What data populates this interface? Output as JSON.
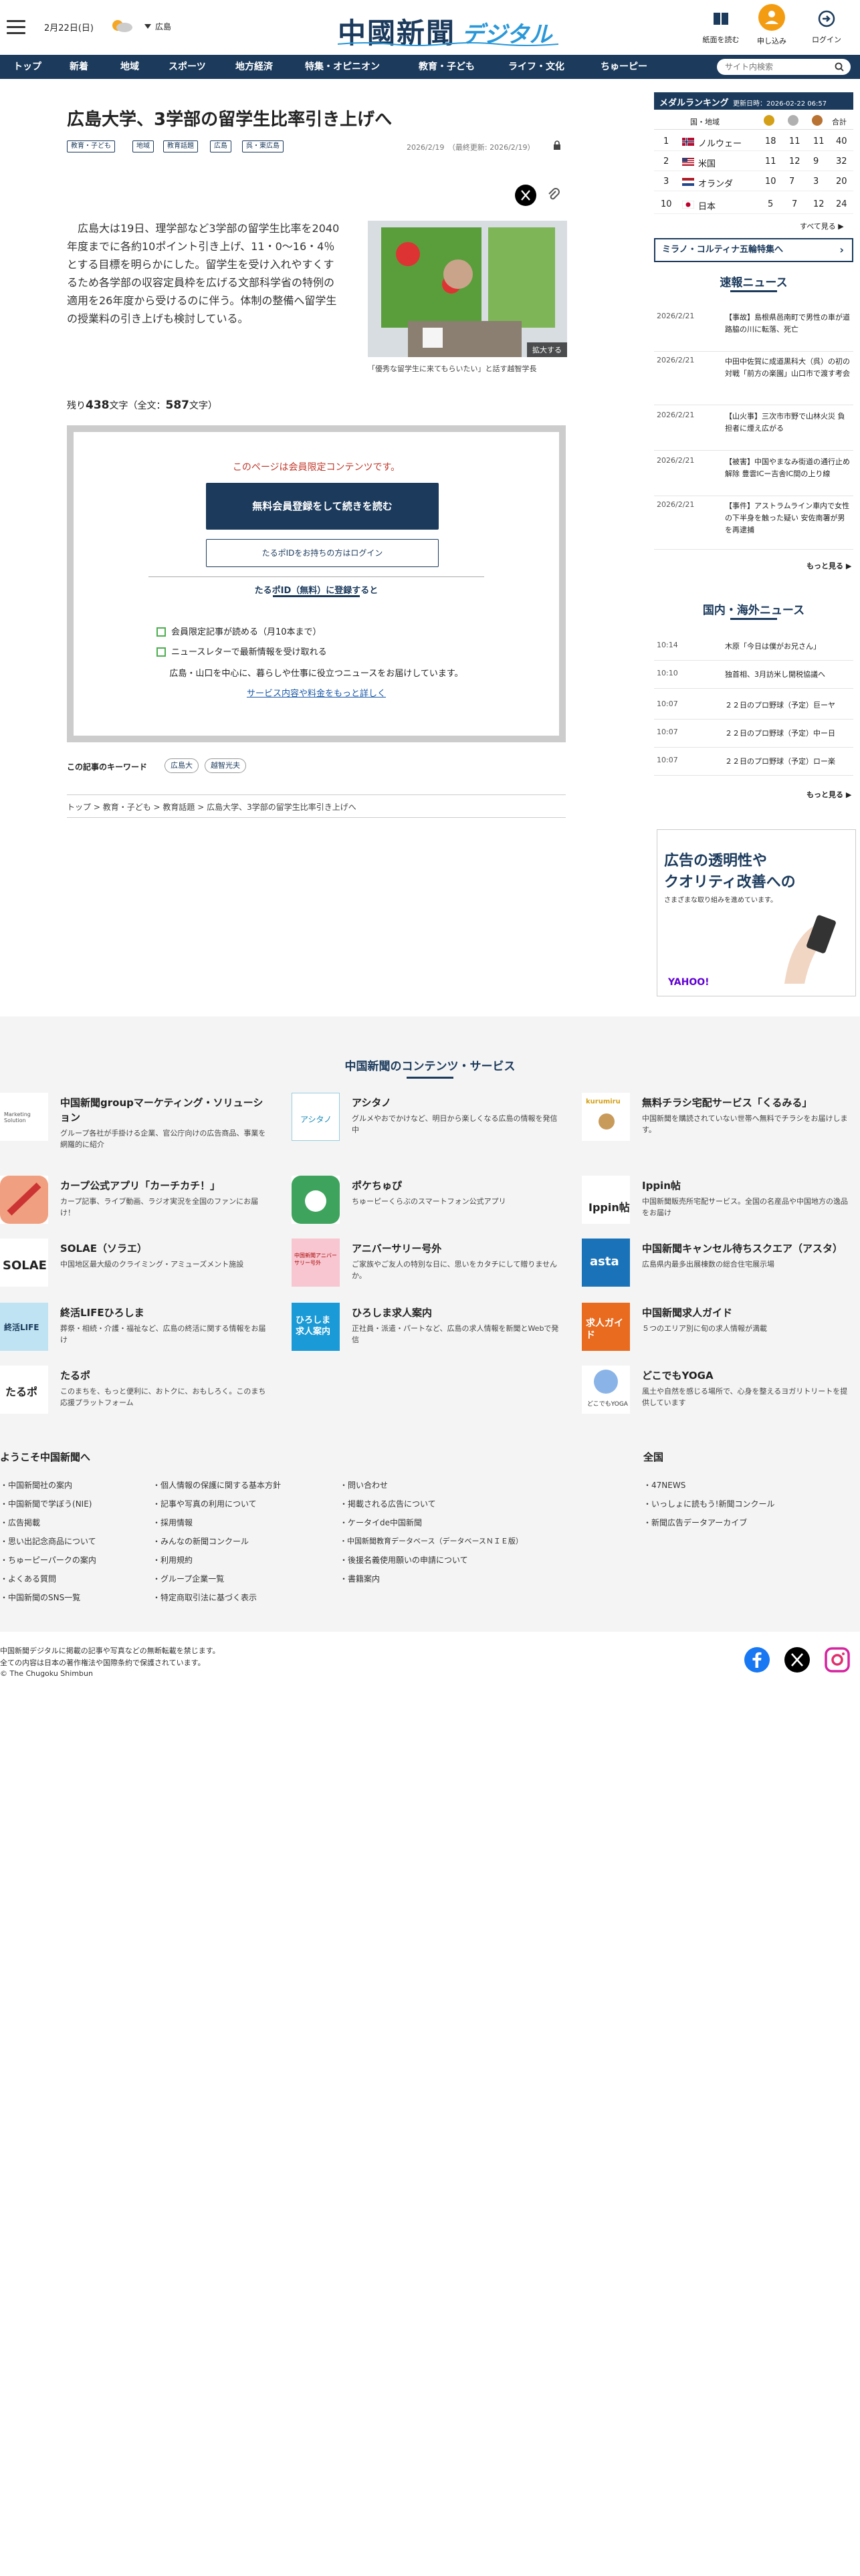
{
  "header": {
    "date": "2月22日(日)",
    "region": "広島",
    "logo_main": "中國新聞",
    "logo_sub": "デジタル",
    "icons": [
      {
        "label": "紙面を読む",
        "icon": "newspaper-icon"
      },
      {
        "label": "申し込み",
        "icon": "signup-icon"
      },
      {
        "label": "ログイン",
        "icon": "login-icon"
      }
    ]
  },
  "nav": {
    "items": [
      "トップ",
      "新着",
      "地域",
      "スポーツ",
      "地方経済",
      "特集・オピニオン",
      "教育・子ども",
      "ライフ・文化",
      "ちゅーピー"
    ],
    "search_placeholder": "サイト内検索"
  },
  "article": {
    "title": "広島大学、3学部の留学生比率引き上げへ",
    "tags": [
      "教育・子ども",
      "地域",
      "教育話題",
      "広島",
      "呉・東広島"
    ],
    "date": "2026/2/19",
    "updated": "（最終更新: 2026/2/19）",
    "body": "　広島大は19日、理学部など3学部の留学生比率を2040年度までに各約10ポイント引き上げ、11・0〜16・4％とする目標を明らかにした。留学生を受け入れやすくするため各学部の収容定員枠を広げる文部科学省の特例の適用を26年度から受けるのに伴う。体制の整備へ留学生の授業料の引き上げも検討している。",
    "photo_enlarge": "拡大する",
    "photo_caption": "「優秀な留学生に来てもらいたい」と話す越智学長",
    "remain_prefix": "残り",
    "remain_count": "438",
    "remain_mid": "文字（全文：",
    "total_count": "587",
    "remain_suffix": "文字）"
  },
  "paywall": {
    "limited": "このページは会員限定コンテンツです。",
    "register_btn": "無料会員登録をして続きを読む",
    "login_btn": "たるポIDをお持ちの方はログイン",
    "reg_heading": "たるポID（無料）に登録すると",
    "benefits": [
      "会員限定記事が読める（月10本まで）",
      "ニュースレターで最新情報を受け取れる"
    ],
    "note": "広島・山口を中心に、暮らしや仕事に役立つニュースをお届けしています。",
    "more_link": "サービス内容や料金をもっと詳しく"
  },
  "keywords": {
    "label": "この記事のキーワード",
    "items": [
      "広島大",
      "越智光夫"
    ]
  },
  "breadcrumb": [
    "トップ",
    "教育・子ども",
    "教育話題",
    "広島大学、3学部の留学生比率引き上げへ"
  ],
  "medal": {
    "title": "メダルランキング",
    "updated": "更新日時：2026-02-22 06:57",
    "col_country": "国・地域",
    "col_total": "合計",
    "rows": [
      {
        "rank": "1",
        "country": "ノルウェー",
        "g": "18",
        "s": "11",
        "b": "11",
        "t": "40",
        "flag": "norway-flag-icon"
      },
      {
        "rank": "2",
        "country": "米国",
        "g": "11",
        "s": "12",
        "b": "9",
        "t": "32",
        "flag": "usa-flag-icon"
      },
      {
        "rank": "3",
        "country": "オランダ",
        "g": "10",
        "s": "7",
        "b": "3",
        "t": "20",
        "flag": "netherlands-flag-icon"
      },
      {
        "rank": "10",
        "country": "日本",
        "g": "5",
        "s": "7",
        "b": "12",
        "t": "24",
        "flag": "japan-flag-icon"
      }
    ],
    "see_all": "すべて見る ▶"
  },
  "milano": "ミラノ・コルティナ五輪特集へ",
  "breaking": {
    "title": "速報ニュース",
    "items": [
      {
        "date": "2026/2/21",
        "text": "【事故】島根県邑南町で男性の車が道路脇の川に転落、死亡"
      },
      {
        "date": "2026/2/21",
        "text": "中田中佐賀に成道黒科大（呉）の初の対戦「前方の楽園」山口市で渡す考会"
      },
      {
        "date": "2026/2/21",
        "text": "【山火事】三次市市野で山林火災 負担者に煙え広がる"
      },
      {
        "date": "2026/2/21",
        "text": "【被害】中国やまなみ街道の通行止め解除 豊雲ICー吉舎IC間の上り線"
      },
      {
        "date": "2026/2/21",
        "text": "【事件】アストラムライン車内で女性の下半身を触った疑い 安佐南署が男を再逮捕"
      }
    ],
    "more": "もっと見る ▶"
  },
  "domestic": {
    "title": "国内・海外ニュース",
    "items": [
      {
        "date": "10:14",
        "text": "木原「今日は僕がお兄さん」"
      },
      {
        "date": "10:10",
        "text": "独首相、3月訪米し開税協議へ"
      },
      {
        "date": "10:07",
        "text": "２２日のプロ野球（予定）巨ーヤ"
      },
      {
        "date": "10:07",
        "text": "２２日のプロ野球（予定）中ー日"
      },
      {
        "date": "10:07",
        "text": "２２日のプロ野球（予定）ロー楽"
      }
    ],
    "more": "もっと見る ▶"
  },
  "ad": {
    "line1": "広告の透明性や",
    "line2": "クオリティ改善への",
    "line3": "さまざまな取り組みを進めています。",
    "brand": "YAHOO!"
  },
  "services": {
    "title": "中国新聞のコンテンツ・サービス",
    "items": [
      {
        "name": "中国新聞groupマーケティング・ソリューション",
        "desc": "グループ各社が手掛ける企業、官公庁向けの広告商品、事業を網羅的に紹介",
        "logo": "chugoku-marketing-logo",
        "logo_text": "Marketing Solution"
      },
      {
        "name": "アシタノ",
        "desc": "グルメやおでかけなど、明日から楽しくなる広島の情報を発信中",
        "logo": "ashitano-logo",
        "logo_text": "アシタノ"
      },
      {
        "name": "無料チラシ宅配サービス「くるみる」",
        "desc": "中国新聞を購読されていない世帯へ無料でチラシをお届けします。",
        "logo": "kurumiru-logo",
        "logo_text": "kurumiru"
      },
      {
        "name": "カープ公式アプリ「カーチカチ！」",
        "desc": "カープ記事、ライブ動画、ラジオ実況を全国のファンにお届け！",
        "logo": "carp-app-logo",
        "logo_text": ""
      },
      {
        "name": "ポケちゅぴ",
        "desc": "ちゅーピーくらぶのスマートフォン公式アプリ",
        "logo": "pokechupi-logo",
        "logo_text": ""
      },
      {
        "name": "Ippin帖",
        "desc": "中国新聞販売所宅配サービス。全国の名産品や中国地方の逸品をお届け",
        "logo": "ippincho-logo",
        "logo_text": "Ippin帖"
      },
      {
        "name": "SOLAE（ソラエ）",
        "desc": "中国地区最大級のクライミング・アミューズメント施設",
        "logo": "solae-logo",
        "logo_text": "SOLAE"
      },
      {
        "name": "アニバーサリー号外",
        "desc": "ご家族やご友人の特別な日に、思いをカタチにして贈りませんか。",
        "logo": "anniversary-logo",
        "logo_text": "中国新聞アニバーサリー号外"
      },
      {
        "name": "中国新聞キャンセル待ちスクエア（アスタ）",
        "desc": "広島県内最多出展棟数の総合住宅展示場",
        "logo": "asta-logo",
        "logo_text": "asta"
      },
      {
        "name": "終活LIFEひろしま",
        "desc": "葬祭・相続・介護・福祉など、広島の終活に関する情報をお届け",
        "logo": "shukatsu-logo",
        "logo_text": "終活LIFE"
      },
      {
        "name": "ひろしま求人案内",
        "desc": "正社員・派遣・パートなど、広島の求人情報を新聞とWebで発信",
        "logo": "hiroshima-kyujin-logo",
        "logo_text": "ひろしま求人案内"
      },
      {
        "name": "中国新聞求人ガイド",
        "desc": "５つのエリア別に旬の求人情報が満載",
        "logo": "kyujin-guide-logo",
        "logo_text": "求人ガイド"
      },
      {
        "name": "たるポ",
        "desc": "このまちを、もっと便利に、おトクに、おもしろく。このまち応援プラットフォーム",
        "logo": "tarupo-logo",
        "logo_text": "たるポ"
      },
      {
        "name": "どこでもYOGA",
        "desc": "風土や自然を感じる場所で、心身を整えるヨガリトリートを提供しています",
        "logo": "yoga-logo",
        "logo_text": "どこでもYOGA"
      }
    ]
  },
  "footer": {
    "welcome": "ようこそ中国新聞へ",
    "col1": [
      "中国新聞社の案内",
      "中国新聞で学ぼう(NIE)",
      "広告掲載",
      "思い出記念商品について",
      "ちゅーピーパークの案内",
      "よくある質問",
      "中国新聞のSNS一覧"
    ],
    "col2": [
      "個人情報の保護に関する基本方針",
      "記事や写真の利用について",
      "採用情報",
      "みんなの新聞コンクール",
      "利用規約",
      "グループ企業一覧",
      "特定商取引法に基づく表示"
    ],
    "col3": [
      "問い合わせ",
      "掲載される広告について",
      "ケータイde中国新聞",
      "中国新聞教育データベース（データベースＮＩＥ版）",
      "後援名義使用願いの申請について",
      "書籍案内"
    ],
    "national": "全国",
    "col4": [
      "47NEWS",
      "いっしょに読もう!新聞コンクール",
      "新聞広告データアーカイブ"
    ],
    "copy1": "中国新聞デジタルに掲載の記事や写真などの無断転載を禁じます。",
    "copy2": "全ての内容は日本の著作権法や国際条約で保護されています。",
    "copy3": "© The Chugoku Shimbun"
  }
}
